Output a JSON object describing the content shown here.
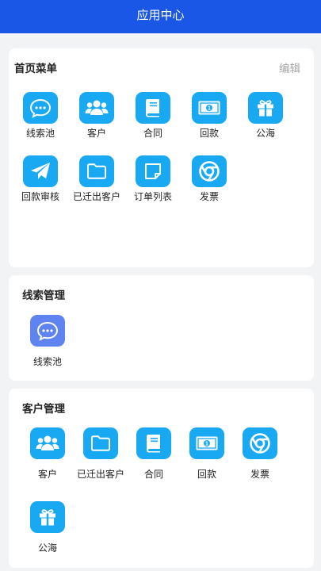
{
  "header": {
    "title": "应用中心"
  },
  "home_menu": {
    "title": "首页菜单",
    "edit_label": "编辑",
    "items": [
      {
        "label": "线索池",
        "icon": "chat-bubble-icon"
      },
      {
        "label": "客户",
        "icon": "users-icon"
      },
      {
        "label": "合同",
        "icon": "book-icon"
      },
      {
        "label": "回款",
        "icon": "banknote-icon"
      },
      {
        "label": "公海",
        "icon": "gift-icon"
      },
      {
        "label": "回款审核",
        "icon": "paper-plane-icon"
      },
      {
        "label": "已迁出客户",
        "icon": "folder-icon"
      },
      {
        "label": "订单列表",
        "icon": "note-icon"
      },
      {
        "label": "发票",
        "icon": "chrome-icon"
      }
    ]
  },
  "leads": {
    "title": "线索管理",
    "items": [
      {
        "label": "线索池",
        "icon": "chat-bubble-icon"
      }
    ]
  },
  "customers": {
    "title": "客户管理",
    "items": [
      {
        "label": "客户",
        "icon": "users-icon"
      },
      {
        "label": "已迁出客户",
        "icon": "folder-icon"
      },
      {
        "label": "合同",
        "icon": "book-icon"
      },
      {
        "label": "回款",
        "icon": "banknote-icon"
      },
      {
        "label": "发票",
        "icon": "chrome-icon"
      },
      {
        "label": "公海",
        "icon": "gift-icon"
      }
    ]
  },
  "colors": {
    "header": "#1a57e6",
    "tile": "#19a9f3",
    "tile_purple": "#5f84ef",
    "background": "#f2f3f5"
  }
}
